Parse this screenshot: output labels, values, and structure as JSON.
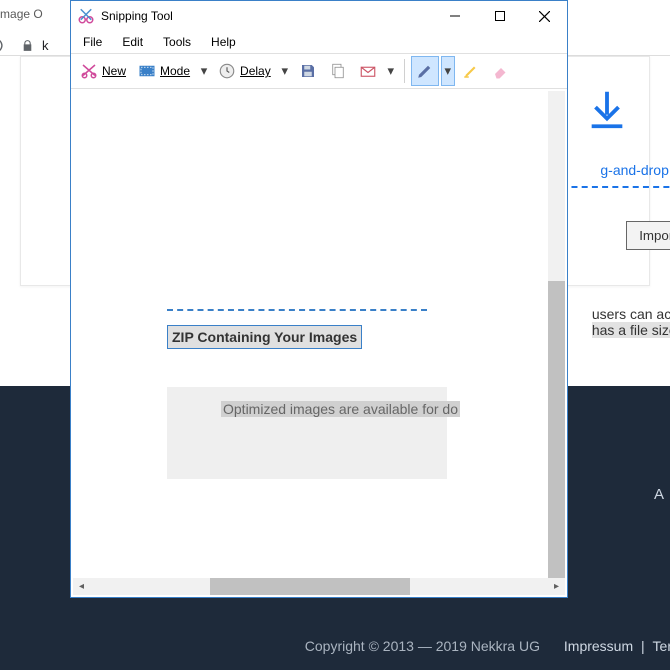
{
  "browser": {
    "tab_title": "nline Image O",
    "url_fragment": "k",
    "reload_icon": "reload-icon",
    "secure_icon": "lock-icon"
  },
  "webpage": {
    "drag_text": "g-and-drop your",
    "import_button": "Import",
    "hint_text_pre": " users can access",
    "hint_text_hl": "has a file size lim",
    "about_label": "A",
    "copyright": "Copyright © 2013 — 2019 Nekkra UG",
    "footer_link1": "Impressum",
    "footer_sep": " | ",
    "footer_link2": "Ter"
  },
  "snipping": {
    "app_title": "Snipping Tool",
    "menu": {
      "file": "File",
      "edit": "Edit",
      "tools": "Tools",
      "help": "Help"
    },
    "toolbar": {
      "new": "New",
      "mode": "Mode",
      "delay": "Delay"
    },
    "content": {
      "zip_heading": "ZIP Containing Your Images",
      "opt_text": "Optimized images are available for do"
    }
  }
}
